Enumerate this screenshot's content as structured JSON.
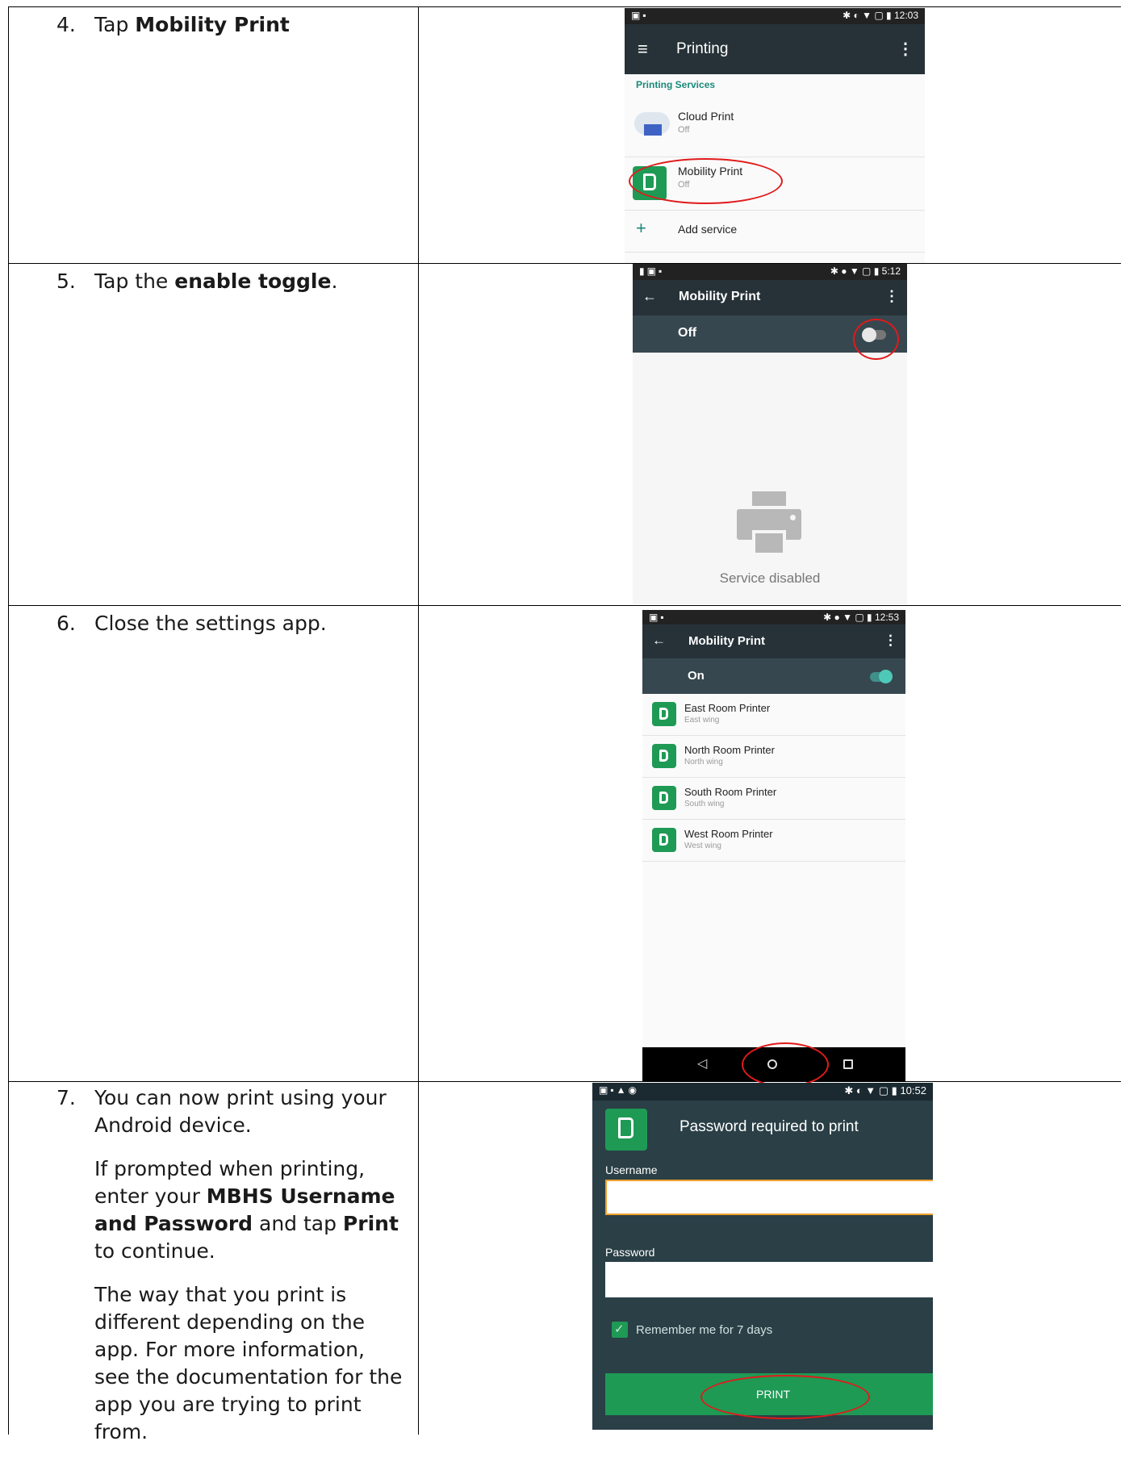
{
  "steps": [
    {
      "num": "4.",
      "pre": "Tap ",
      "bold": "Mobility Print",
      "post": ""
    },
    {
      "num": "5.",
      "pre": "Tap the ",
      "bold": "enable toggle",
      "post": "."
    },
    {
      "num": "6.",
      "text": "Close the settings app."
    },
    {
      "num": "7.",
      "p1": "You can now print using your Android device.",
      "p2_pre": "If prompted when printing, enter your ",
      "p2_bold1": "MBHS Username and Password",
      "p2_mid": " and tap ",
      "p2_bold2": "Print",
      "p2_post": " to continue.",
      "p3": "The way that you print is different depending on the app. For more information, see the documentation for the app you are trying to print from."
    }
  ],
  "screen1": {
    "time": "12:03",
    "title": "Printing",
    "section": "Printing Services",
    "items": [
      {
        "name": "Cloud Print",
        "status": "Off"
      },
      {
        "name": "Mobility Print",
        "status": "Off"
      }
    ],
    "add": "Add service"
  },
  "screen2": {
    "time": "5:12",
    "title": "Mobility Print",
    "toggle_label": "Off",
    "toggle_on": false,
    "empty_text": "Service disabled"
  },
  "screen3": {
    "time": "12:53",
    "title": "Mobility Print",
    "toggle_label": "On",
    "toggle_on": true,
    "printers": [
      {
        "name": "East Room Printer",
        "location": "East wing"
      },
      {
        "name": "North Room Printer",
        "location": "North wing"
      },
      {
        "name": "South Room Printer",
        "location": "South wing"
      },
      {
        "name": "West Room Printer",
        "location": "West wing"
      }
    ]
  },
  "screen4": {
    "time": "10:52",
    "title": "Password required to print",
    "username_label": "Username",
    "password_label": "Password",
    "remember": "Remember me for 7 days",
    "button": "PRINT"
  },
  "colors": {
    "appbar_dark": "#263238",
    "appbar_toggle_row": "#37474f",
    "accent_green": "#1e9a55",
    "teal_link": "#1a8a7a",
    "highlight_red": "#e11a1a"
  }
}
